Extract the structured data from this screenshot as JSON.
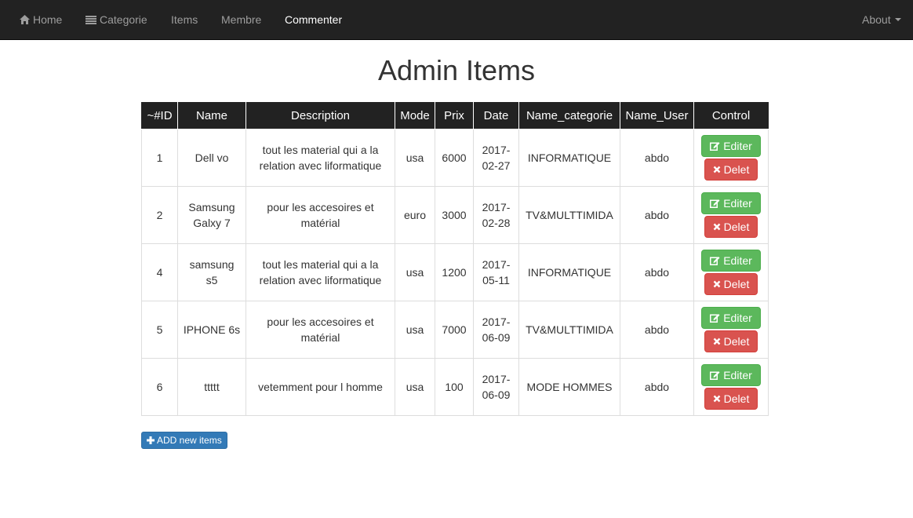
{
  "navbar": {
    "home": "Home",
    "categorie": "Categorie",
    "items": "Items",
    "membre": "Membre",
    "commenter": "Commenter",
    "about": "About",
    "icons": {
      "home": "home-icon",
      "categorie": "list-icon"
    }
  },
  "page": {
    "title": "Admin Items"
  },
  "table": {
    "headers": [
      "~#ID",
      "Name",
      "Description",
      "Mode",
      "Prix",
      "Date",
      "Name_categorie",
      "Name_User",
      "Control"
    ],
    "rows": [
      {
        "id": "1",
        "name": "Dell vo",
        "description": "tout les material qui a la relation avec liformatique",
        "mode": "usa",
        "prix": "6000",
        "date": "2017-02-27",
        "categorie": "INFORMATIQUE",
        "user": "abdo"
      },
      {
        "id": "2",
        "name": "Samsung Galxy 7",
        "description": "pour les accesoires et matérial",
        "mode": "euro",
        "prix": "3000",
        "date": "2017-02-28",
        "categorie": "TV&MULTTIMIDA",
        "user": "abdo"
      },
      {
        "id": "4",
        "name": "samsung s5",
        "description": "tout les material qui a la relation avec liformatique",
        "mode": "usa",
        "prix": "1200",
        "date": "2017-05-11",
        "categorie": "INFORMATIQUE",
        "user": "abdo"
      },
      {
        "id": "5",
        "name": "IPHONE 6s",
        "description": "pour les accesoires et matérial",
        "mode": "usa",
        "prix": "7000",
        "date": "2017-06-09",
        "categorie": "TV&MULTTIMIDA",
        "user": "abdo"
      },
      {
        "id": "6",
        "name": "ttttt",
        "description": "vetemment pour l homme",
        "mode": "usa",
        "prix": "100",
        "date": "2017-06-09",
        "categorie": "MODE HOMMES",
        "user": "abdo"
      }
    ],
    "edit_label": "Editer",
    "delete_label": "Delet"
  },
  "add_button": {
    "label": "ADD new items",
    "icon": "plus-icon"
  },
  "colors": {
    "navbar_bg": "#222222",
    "nav_text": "#9d9d9d",
    "success": "#5cb85c",
    "danger": "#d9534f",
    "primary": "#337ab7"
  }
}
